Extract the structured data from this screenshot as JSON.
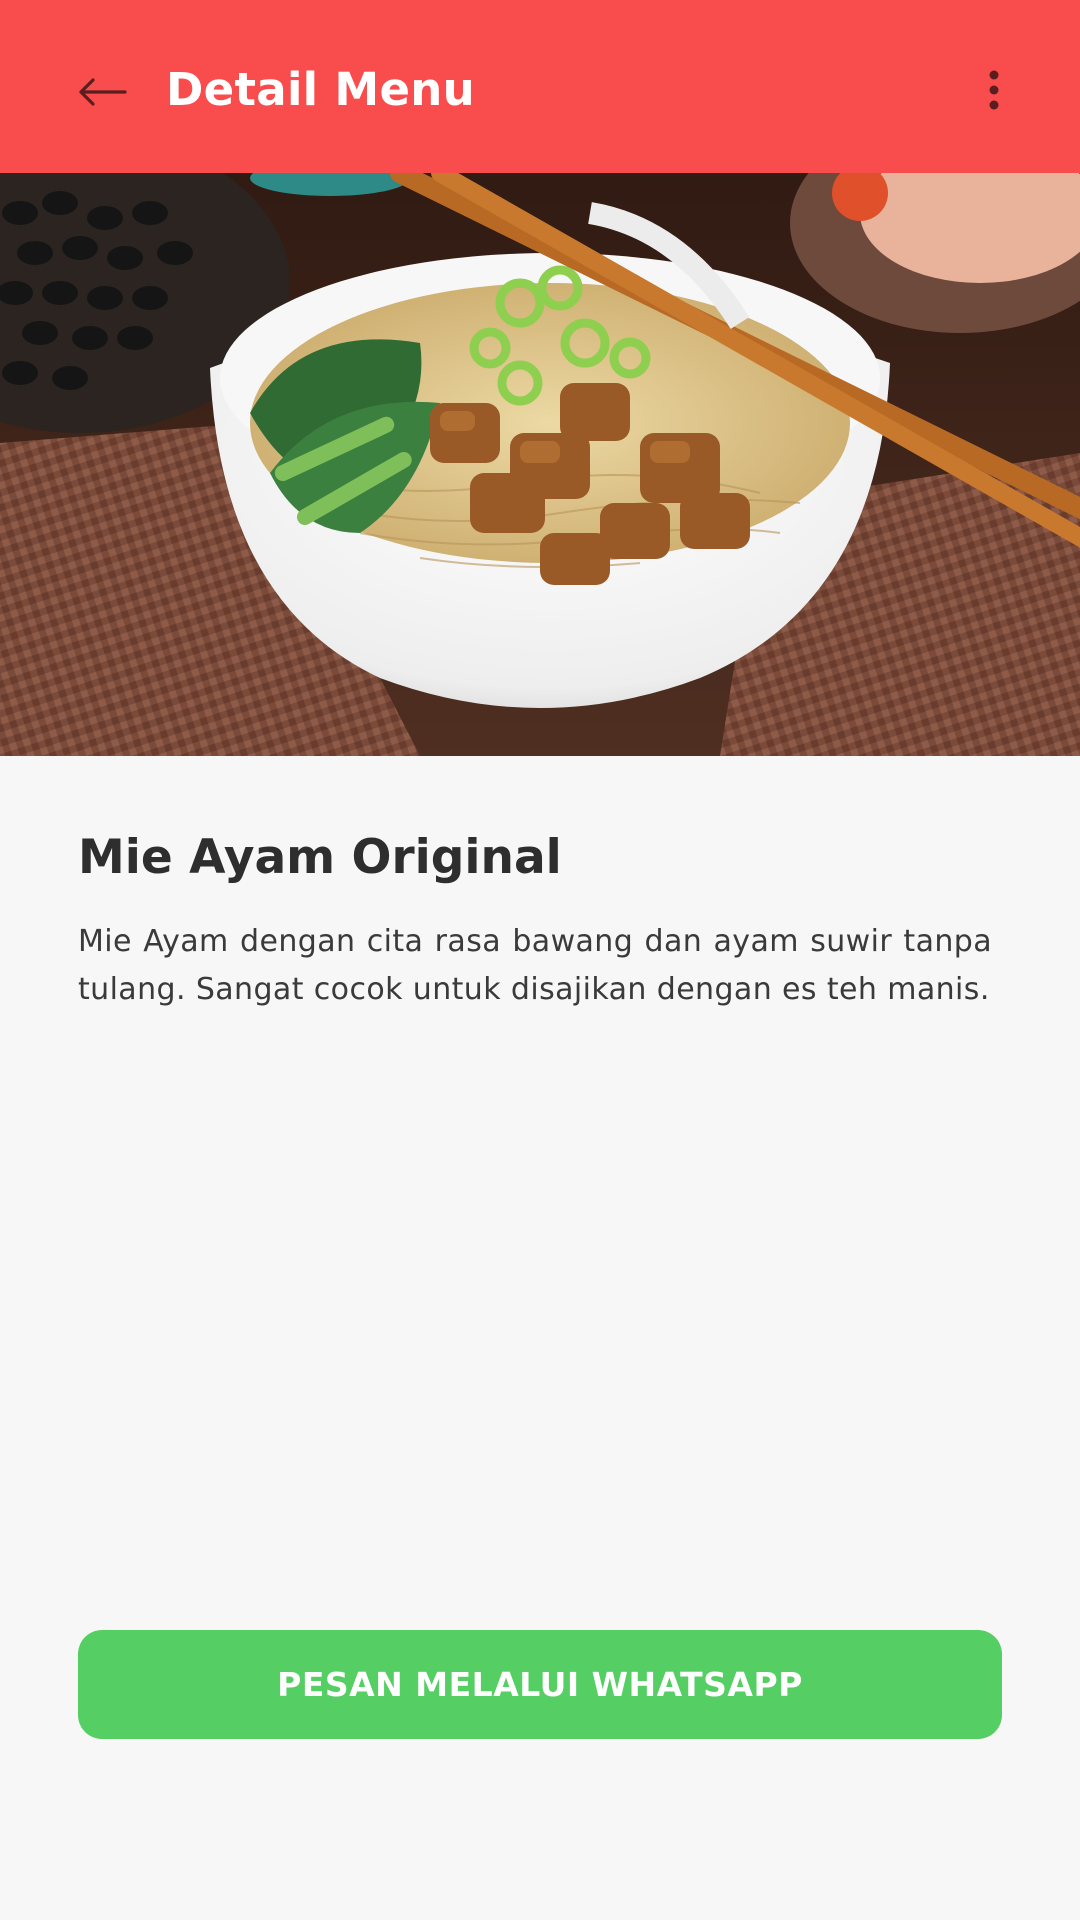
{
  "app_bar": {
    "title": "Detail Menu",
    "back_icon": "arrow-left-icon",
    "more_icon": "more-vertical-icon",
    "background_color": "#f94c4c"
  },
  "hero_image": {
    "subject": "bowl of chicken noodles with greens, scallions and chopsticks"
  },
  "menu": {
    "name": "Mie Ayam Original",
    "description": "Mie Ayam dengan cita rasa bawang dan ayam suwir tanpa tulang. Sangat cocok untuk disajikan dengan es teh manis."
  },
  "order_button": {
    "label": "PESAN MELALUI WHATSAPP",
    "color": "#55cf63"
  }
}
